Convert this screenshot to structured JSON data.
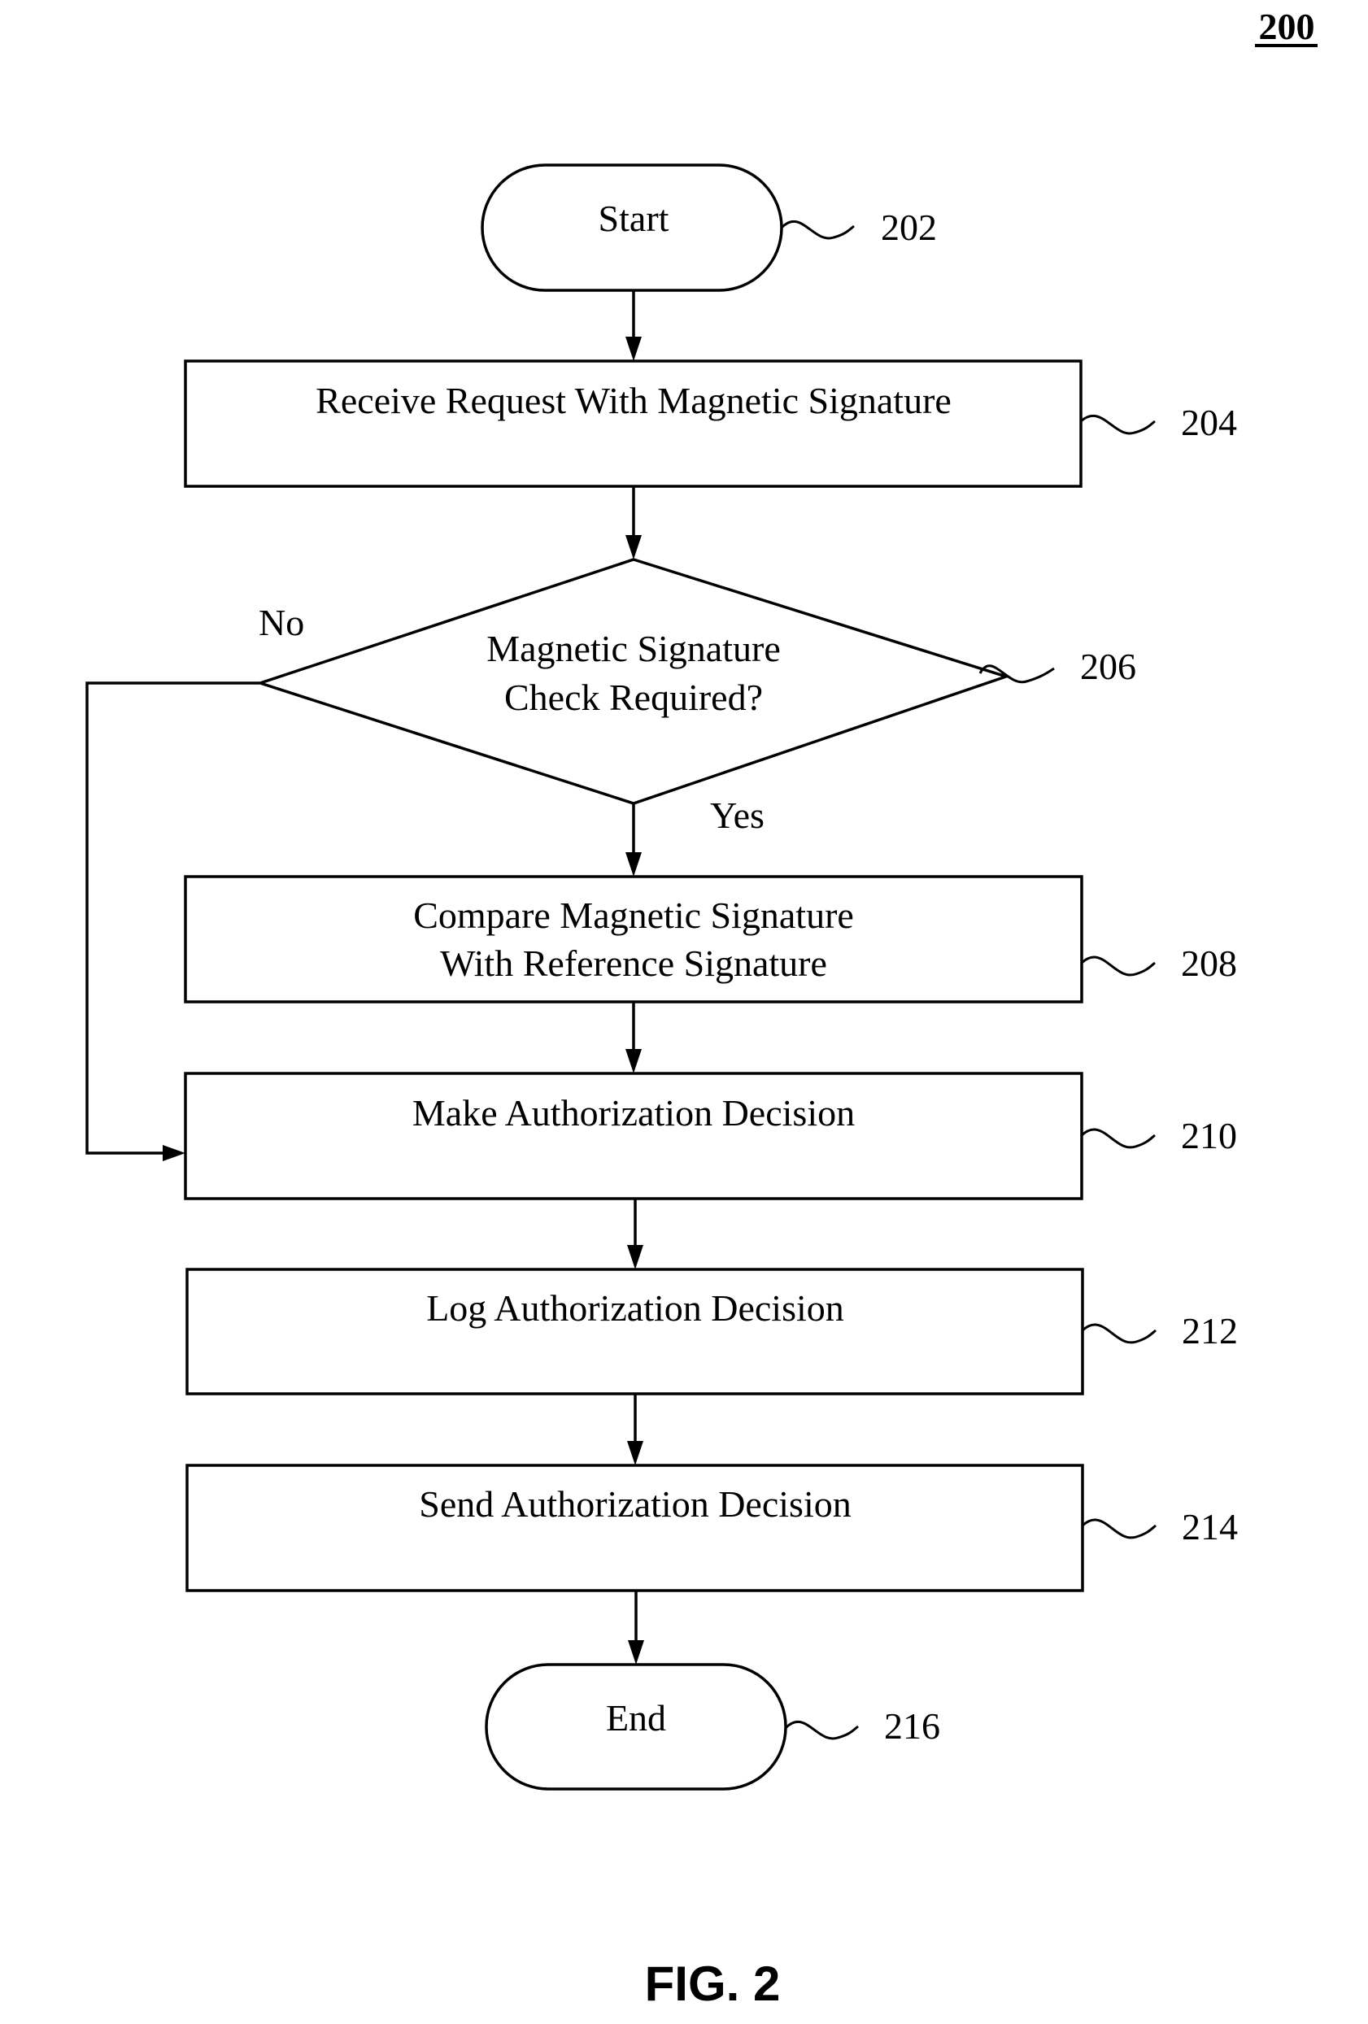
{
  "figure": {
    "number_label": "200",
    "caption": "FIG. 2"
  },
  "nodes": [
    {
      "id": "202",
      "type": "terminal",
      "text": [
        "Start"
      ],
      "ref": "202"
    },
    {
      "id": "204",
      "type": "process",
      "text": [
        "Receive Request With Magnetic Signature"
      ],
      "ref": "204"
    },
    {
      "id": "206",
      "type": "decision",
      "text": [
        "Magnetic Signature",
        "Check Required?"
      ],
      "ref": "206"
    },
    {
      "id": "208",
      "type": "process",
      "text": [
        "Compare Magnetic Signature",
        "With Reference Signature"
      ],
      "ref": "208"
    },
    {
      "id": "210",
      "type": "process",
      "text": [
        "Make Authorization Decision"
      ],
      "ref": "210"
    },
    {
      "id": "212",
      "type": "process",
      "text": [
        "Log Authorization Decision"
      ],
      "ref": "212"
    },
    {
      "id": "214",
      "type": "process",
      "text": [
        "Send Authorization Decision"
      ],
      "ref": "214"
    },
    {
      "id": "216",
      "type": "terminal",
      "text": [
        "End"
      ],
      "ref": "216"
    }
  ],
  "edges": [
    {
      "from": "202",
      "to": "204",
      "label": ""
    },
    {
      "from": "204",
      "to": "206",
      "label": ""
    },
    {
      "from": "206",
      "to": "208",
      "label": "Yes"
    },
    {
      "from": "206",
      "to": "210",
      "label": "No"
    },
    {
      "from": "208",
      "to": "210",
      "label": ""
    },
    {
      "from": "210",
      "to": "212",
      "label": ""
    },
    {
      "from": "212",
      "to": "214",
      "label": ""
    },
    {
      "from": "214",
      "to": "216",
      "label": ""
    }
  ],
  "branch_labels": {
    "yes": "Yes",
    "no": "No"
  }
}
